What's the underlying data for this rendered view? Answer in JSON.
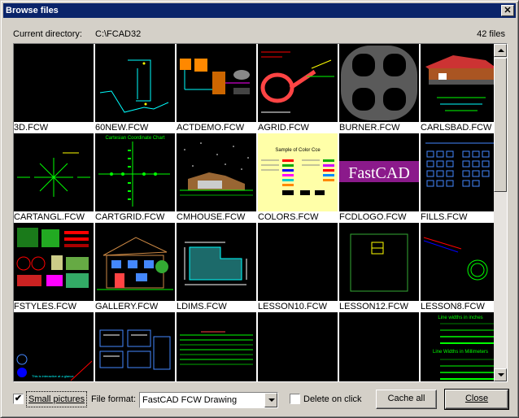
{
  "window": {
    "title": "Browse files",
    "close_glyph": "✕"
  },
  "directory": {
    "label": "Current directory:",
    "value": "C:\\FCAD32"
  },
  "file_count": "42 files",
  "files": [
    "3D.FCW",
    "60NEW.FCW",
    "ACTDEMO.FCW",
    "AGRID.FCW",
    "BURNER.FCW",
    "CARLSBAD.FCW",
    "CARTANGL.FCW",
    "CARTGRID.FCW",
    "CMHOUSE.FCW",
    "COLORS.FCW",
    "FCDLOGO.FCW",
    "FILLS.FCW",
    "FSTYLES.FCW",
    "GALLERY.FCW",
    "LDIMS.FCW",
    "LESSON10.FCW",
    "LESSON12.FCW",
    "LESSON8.FCW",
    "",
    "",
    "",
    "",
    "",
    ""
  ],
  "thumb_text": {
    "cartgrid_title": "Cartesian Coordinate Chart",
    "colors_title": "Sample of Color Cce",
    "fcdlogo": "FastCAD",
    "row4_legend": "This is interactive at a glance",
    "lesson_inches": "Line widths in inches",
    "lesson_mm": "Line Widths in Millimeters"
  },
  "controls": {
    "small_pictures_checked": "✔",
    "small_pictures_label": "Small pictures",
    "file_format_label": "File format:",
    "file_format_value": "FastCAD FCW Drawing",
    "delete_on_click_label": "Delete on click",
    "cache_all_label": "Cache all",
    "close_label": "Close"
  },
  "colors": {
    "titlebar": "#0a246a",
    "face": "#d4d0c8",
    "thumb_bg": "#000000"
  }
}
